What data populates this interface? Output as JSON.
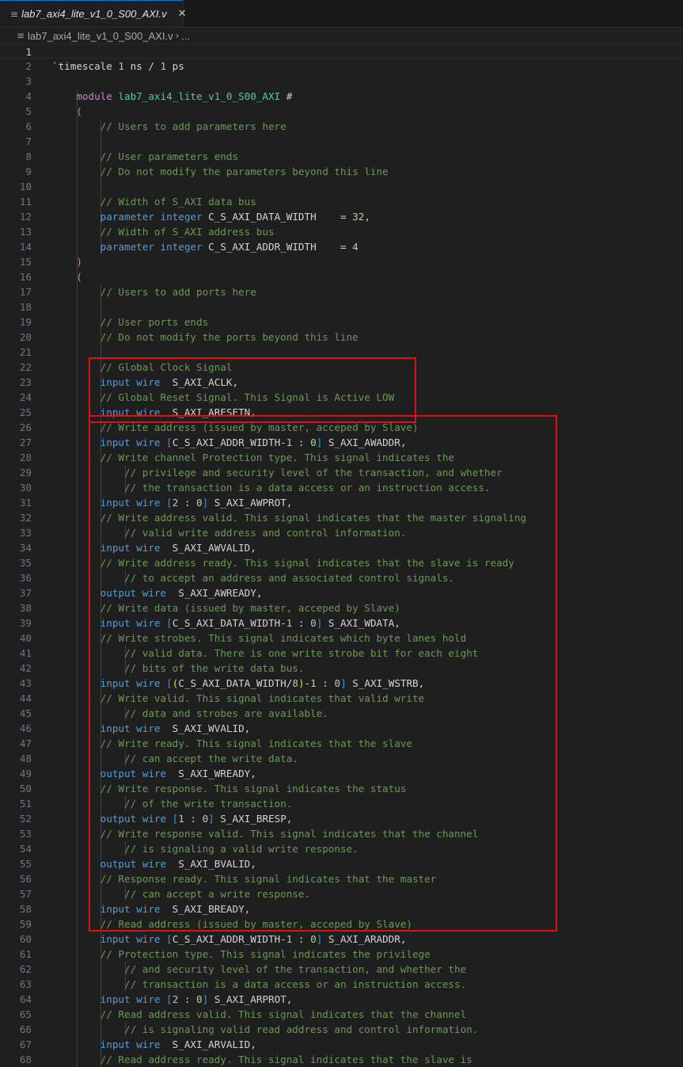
{
  "tab": {
    "title": "lab7_axi4_lite_v1_0_S00_AXI.v",
    "file_icon": "≡",
    "close_icon": "✕"
  },
  "breadcrumb": {
    "file": "lab7_axi4_lite_v1_0_S00_AXI.v",
    "separator": "›",
    "more": "..."
  },
  "highlights": [
    {
      "name": "highlight-global-signals",
      "from_line": 22,
      "to_line": 25
    },
    {
      "name": "highlight-write-channel",
      "from_line": 26,
      "to_line": 59
    }
  ],
  "colors": {
    "keyword": "#569cd6",
    "comment": "#6a9955",
    "number": "#b5cea8",
    "highlight_box": "#e01010",
    "background": "#1f1f1f"
  },
  "lines": [
    {
      "n": "1",
      "t": [],
      "current": true
    },
    {
      "n": "2",
      "t": [
        [
          "`timescale ",
          "df"
        ],
        [
          "1",
          "nm"
        ],
        [
          " ns / ",
          "df"
        ],
        [
          "1",
          "nm"
        ],
        [
          " ps",
          "df"
        ]
      ]
    },
    {
      "n": "3",
      "t": []
    },
    {
      "n": "4",
      "t": [
        [
          "    "
        ],
        [
          "module ",
          "kc"
        ],
        [
          "lab7_axi4_lite_v1_0_S00_AXI",
          "ty"
        ],
        [
          " #",
          "df"
        ]
      ],
      "g": [
        1
      ]
    },
    {
      "n": "5",
      "t": [
        [
          "    "
        ],
        [
          "(",
          "br2"
        ]
      ],
      "g": [
        1
      ]
    },
    {
      "n": "6",
      "t": [
        [
          "        "
        ],
        [
          "// Users to add parameters here",
          "cm"
        ]
      ],
      "g": [
        1,
        2
      ]
    },
    {
      "n": "7",
      "t": [],
      "g": [
        1,
        2
      ]
    },
    {
      "n": "8",
      "t": [
        [
          "        "
        ],
        [
          "// User parameters ends",
          "cm"
        ]
      ],
      "g": [
        1,
        2
      ]
    },
    {
      "n": "9",
      "t": [
        [
          "        "
        ],
        [
          "// Do not modify the parameters beyond this line",
          "cm"
        ]
      ],
      "g": [
        1,
        2
      ]
    },
    {
      "n": "10",
      "t": [],
      "g": [
        1,
        2
      ]
    },
    {
      "n": "11",
      "t": [
        [
          "        "
        ],
        [
          "// Width of S_AXI data bus",
          "cm"
        ]
      ],
      "g": [
        1,
        2
      ]
    },
    {
      "n": "12",
      "t": [
        [
          "        "
        ],
        [
          "parameter ",
          "kw"
        ],
        [
          "integer ",
          "kw"
        ],
        [
          "C_S_AXI_DATA_WIDTH    = ",
          "df"
        ],
        [
          "32",
          "nm"
        ],
        [
          ",",
          "df"
        ]
      ],
      "g": [
        1,
        2
      ]
    },
    {
      "n": "13",
      "t": [
        [
          "        "
        ],
        [
          "// Width of S_AXI address bus",
          "cm"
        ]
      ],
      "g": [
        1,
        2
      ]
    },
    {
      "n": "14",
      "t": [
        [
          "        "
        ],
        [
          "parameter ",
          "kw"
        ],
        [
          "integer ",
          "kw"
        ],
        [
          "C_S_AXI_ADDR_WIDTH    = ",
          "df"
        ],
        [
          "4",
          "nm"
        ]
      ],
      "g": [
        1,
        2
      ]
    },
    {
      "n": "15",
      "t": [
        [
          "    "
        ],
        [
          ")",
          "br2"
        ]
      ],
      "g": [
        1
      ]
    },
    {
      "n": "16",
      "t": [
        [
          "    "
        ],
        [
          "(",
          "br2"
        ]
      ],
      "g": [
        1
      ]
    },
    {
      "n": "17",
      "t": [
        [
          "        "
        ],
        [
          "// Users to add ports here",
          "cm"
        ]
      ],
      "g": [
        1,
        2
      ]
    },
    {
      "n": "18",
      "t": [],
      "g": [
        1,
        2
      ]
    },
    {
      "n": "19",
      "t": [
        [
          "        "
        ],
        [
          "// User ports ends",
          "cm"
        ]
      ],
      "g": [
        1,
        2
      ]
    },
    {
      "n": "20",
      "t": [
        [
          "        "
        ],
        [
          "// Do not modify the ports beyond this line",
          "cm"
        ]
      ],
      "g": [
        1,
        2
      ]
    },
    {
      "n": "21",
      "t": [],
      "g": [
        1,
        2
      ]
    },
    {
      "n": "22",
      "t": [
        [
          "        "
        ],
        [
          "// Global Clock Signal",
          "cm"
        ]
      ],
      "g": [
        1,
        2
      ]
    },
    {
      "n": "23",
      "t": [
        [
          "        "
        ],
        [
          "input ",
          "kw"
        ],
        [
          "wire ",
          "kw"
        ],
        [
          " S_AXI_ACLK,",
          "df"
        ]
      ],
      "g": [
        1,
        2
      ]
    },
    {
      "n": "24",
      "t": [
        [
          "        "
        ],
        [
          "// Global Reset Signal. This Signal is Active LOW",
          "cm"
        ]
      ],
      "g": [
        1,
        2
      ]
    },
    {
      "n": "25",
      "t": [
        [
          "        "
        ],
        [
          "input ",
          "kw"
        ],
        [
          "wire ",
          "kw"
        ],
        [
          " S_AXI_ARESETN,",
          "df"
        ]
      ],
      "g": [
        1,
        2
      ]
    },
    {
      "n": "26",
      "t": [
        [
          "        "
        ],
        [
          "// Write address (issued by master, acceped by Slave)",
          "cm"
        ]
      ],
      "g": [
        1,
        2
      ]
    },
    {
      "n": "27",
      "t": [
        [
          "        "
        ],
        [
          "input ",
          "kw"
        ],
        [
          "wire ",
          "kw"
        ],
        [
          "[",
          "br3"
        ],
        [
          "C_S_AXI_ADDR_WIDTH-",
          "df"
        ],
        [
          "1",
          "nm"
        ],
        [
          " : ",
          "df"
        ],
        [
          "0",
          "nm"
        ],
        [
          "]",
          "br3"
        ],
        [
          " S_AXI_AWADDR,",
          "df"
        ]
      ],
      "g": [
        1,
        2
      ]
    },
    {
      "n": "28",
      "t": [
        [
          "        "
        ],
        [
          "// Write channel Protection type. This signal indicates the",
          "cm"
        ]
      ],
      "g": [
        1,
        2
      ]
    },
    {
      "n": "29",
      "t": [
        [
          "            "
        ],
        [
          "// privilege and security level of the transaction, and whether",
          "cm"
        ]
      ],
      "g": [
        1,
        2,
        3
      ]
    },
    {
      "n": "30",
      "t": [
        [
          "            "
        ],
        [
          "// the transaction is a data access or an instruction access.",
          "cm"
        ]
      ],
      "g": [
        1,
        2,
        3
      ]
    },
    {
      "n": "31",
      "t": [
        [
          "        "
        ],
        [
          "input ",
          "kw"
        ],
        [
          "wire ",
          "kw"
        ],
        [
          "[",
          "br3"
        ],
        [
          "2",
          "nm"
        ],
        [
          " : ",
          "df"
        ],
        [
          "0",
          "nm"
        ],
        [
          "]",
          "br3"
        ],
        [
          " S_AXI_AWPROT,",
          "df"
        ]
      ],
      "g": [
        1,
        2
      ]
    },
    {
      "n": "32",
      "t": [
        [
          "        "
        ],
        [
          "// Write address valid. This signal indicates that the master signaling",
          "cm"
        ]
      ],
      "g": [
        1,
        2
      ]
    },
    {
      "n": "33",
      "t": [
        [
          "            "
        ],
        [
          "// valid write address and control information.",
          "cm"
        ]
      ],
      "g": [
        1,
        2,
        3
      ]
    },
    {
      "n": "34",
      "t": [
        [
          "        "
        ],
        [
          "input ",
          "kw"
        ],
        [
          "wire ",
          "kw"
        ],
        [
          " S_AXI_AWVALID,",
          "df"
        ]
      ],
      "g": [
        1,
        2
      ]
    },
    {
      "n": "35",
      "t": [
        [
          "        "
        ],
        [
          "// Write address ready. This signal indicates that the slave is ready",
          "cm"
        ]
      ],
      "g": [
        1,
        2
      ]
    },
    {
      "n": "36",
      "t": [
        [
          "            "
        ],
        [
          "// to accept an address and associated control signals.",
          "cm"
        ]
      ],
      "g": [
        1,
        2,
        3
      ]
    },
    {
      "n": "37",
      "t": [
        [
          "        "
        ],
        [
          "output ",
          "kw"
        ],
        [
          "wire ",
          "kw"
        ],
        [
          " S_AXI_AWREADY,",
          "df"
        ]
      ],
      "g": [
        1,
        2
      ]
    },
    {
      "n": "38",
      "t": [
        [
          "        "
        ],
        [
          "// Write data (issued by master, acceped by Slave)",
          "cm"
        ]
      ],
      "g": [
        1,
        2
      ]
    },
    {
      "n": "39",
      "t": [
        [
          "        "
        ],
        [
          "input ",
          "kw"
        ],
        [
          "wire ",
          "kw"
        ],
        [
          "[",
          "br3"
        ],
        [
          "C_S_AXI_DATA_WIDTH-",
          "df"
        ],
        [
          "1",
          "nm"
        ],
        [
          " : ",
          "df"
        ],
        [
          "0",
          "nm"
        ],
        [
          "]",
          "br3"
        ],
        [
          " S_AXI_WDATA,",
          "df"
        ]
      ],
      "g": [
        1,
        2
      ]
    },
    {
      "n": "40",
      "t": [
        [
          "        "
        ],
        [
          "// Write strobes. This signal indicates which byte lanes hold",
          "cm"
        ]
      ],
      "g": [
        1,
        2
      ]
    },
    {
      "n": "41",
      "t": [
        [
          "            "
        ],
        [
          "// valid data. There is one write strobe bit for each eight",
          "cm"
        ]
      ],
      "g": [
        1,
        2,
        3
      ]
    },
    {
      "n": "42",
      "t": [
        [
          "            "
        ],
        [
          "// bits of the write data bus.",
          "cm"
        ]
      ],
      "g": [
        1,
        2,
        3
      ]
    },
    {
      "n": "43",
      "t": [
        [
          "        "
        ],
        [
          "input ",
          "kw"
        ],
        [
          "wire ",
          "kw"
        ],
        [
          "[",
          "br3"
        ],
        [
          "(",
          "br1"
        ],
        [
          "C_S_AXI_DATA_WIDTH/",
          "df"
        ],
        [
          "8",
          "nm"
        ],
        [
          ")",
          "br1"
        ],
        [
          "-",
          "df"
        ],
        [
          "1",
          "nm"
        ],
        [
          " : ",
          "df"
        ],
        [
          "0",
          "nm"
        ],
        [
          "]",
          "br3"
        ],
        [
          " S_AXI_WSTRB,",
          "df"
        ]
      ],
      "g": [
        1,
        2
      ]
    },
    {
      "n": "44",
      "t": [
        [
          "        "
        ],
        [
          "// Write valid. This signal indicates that valid write",
          "cm"
        ]
      ],
      "g": [
        1,
        2
      ]
    },
    {
      "n": "45",
      "t": [
        [
          "            "
        ],
        [
          "// data and strobes are available.",
          "cm"
        ]
      ],
      "g": [
        1,
        2,
        3
      ]
    },
    {
      "n": "46",
      "t": [
        [
          "        "
        ],
        [
          "input ",
          "kw"
        ],
        [
          "wire ",
          "kw"
        ],
        [
          " S_AXI_WVALID,",
          "df"
        ]
      ],
      "g": [
        1,
        2
      ]
    },
    {
      "n": "47",
      "t": [
        [
          "        "
        ],
        [
          "// Write ready. This signal indicates that the slave",
          "cm"
        ]
      ],
      "g": [
        1,
        2
      ]
    },
    {
      "n": "48",
      "t": [
        [
          "            "
        ],
        [
          "// can accept the write data.",
          "cm"
        ]
      ],
      "g": [
        1,
        2,
        3
      ]
    },
    {
      "n": "49",
      "t": [
        [
          "        "
        ],
        [
          "output ",
          "kw"
        ],
        [
          "wire ",
          "kw"
        ],
        [
          " S_AXI_WREADY,",
          "df"
        ]
      ],
      "g": [
        1,
        2
      ]
    },
    {
      "n": "50",
      "t": [
        [
          "        "
        ],
        [
          "// Write response. This signal indicates the status",
          "cm"
        ]
      ],
      "g": [
        1,
        2
      ]
    },
    {
      "n": "51",
      "t": [
        [
          "            "
        ],
        [
          "// of the write transaction.",
          "cm"
        ]
      ],
      "g": [
        1,
        2,
        3
      ]
    },
    {
      "n": "52",
      "t": [
        [
          "        "
        ],
        [
          "output ",
          "kw"
        ],
        [
          "wire ",
          "kw"
        ],
        [
          "[",
          "br3"
        ],
        [
          "1",
          "nm"
        ],
        [
          " : ",
          "df"
        ],
        [
          "0",
          "nm"
        ],
        [
          "]",
          "br3"
        ],
        [
          " S_AXI_BRESP,",
          "df"
        ]
      ],
      "g": [
        1,
        2
      ]
    },
    {
      "n": "53",
      "t": [
        [
          "        "
        ],
        [
          "// Write response valid. This signal indicates that the channel",
          "cm"
        ]
      ],
      "g": [
        1,
        2
      ]
    },
    {
      "n": "54",
      "t": [
        [
          "            "
        ],
        [
          "// is signaling a valid write response.",
          "cm"
        ]
      ],
      "g": [
        1,
        2,
        3
      ]
    },
    {
      "n": "55",
      "t": [
        [
          "        "
        ],
        [
          "output ",
          "kw"
        ],
        [
          "wire ",
          "kw"
        ],
        [
          " S_AXI_BVALID,",
          "df"
        ]
      ],
      "g": [
        1,
        2
      ]
    },
    {
      "n": "56",
      "t": [
        [
          "        "
        ],
        [
          "// Response ready. This signal indicates that the master",
          "cm"
        ]
      ],
      "g": [
        1,
        2
      ]
    },
    {
      "n": "57",
      "t": [
        [
          "            "
        ],
        [
          "// can accept a write response.",
          "cm"
        ]
      ],
      "g": [
        1,
        2,
        3
      ]
    },
    {
      "n": "58",
      "t": [
        [
          "        "
        ],
        [
          "input ",
          "kw"
        ],
        [
          "wire ",
          "kw"
        ],
        [
          " S_AXI_BREADY,",
          "df"
        ]
      ],
      "g": [
        1,
        2
      ]
    },
    {
      "n": "59",
      "t": [
        [
          "        "
        ],
        [
          "// Read address (issued by master, acceped by Slave)",
          "cm"
        ]
      ],
      "g": [
        1,
        2
      ]
    },
    {
      "n": "60",
      "t": [
        [
          "        "
        ],
        [
          "input ",
          "kw"
        ],
        [
          "wire ",
          "kw"
        ],
        [
          "[",
          "br3"
        ],
        [
          "C_S_AXI_ADDR_WIDTH-",
          "df"
        ],
        [
          "1",
          "nm"
        ],
        [
          " : ",
          "df"
        ],
        [
          "0",
          "nm"
        ],
        [
          "]",
          "br3"
        ],
        [
          " S_AXI_ARADDR,",
          "df"
        ]
      ],
      "g": [
        1,
        2
      ]
    },
    {
      "n": "61",
      "t": [
        [
          "        "
        ],
        [
          "// Protection type. This signal indicates the privilege",
          "cm"
        ]
      ],
      "g": [
        1,
        2
      ]
    },
    {
      "n": "62",
      "t": [
        [
          "            "
        ],
        [
          "// and security level of the transaction, and whether the",
          "cm"
        ]
      ],
      "g": [
        1,
        2,
        3
      ]
    },
    {
      "n": "63",
      "t": [
        [
          "            "
        ],
        [
          "// transaction is a data access or an instruction access.",
          "cm"
        ]
      ],
      "g": [
        1,
        2,
        3
      ]
    },
    {
      "n": "64",
      "t": [
        [
          "        "
        ],
        [
          "input ",
          "kw"
        ],
        [
          "wire ",
          "kw"
        ],
        [
          "[",
          "br3"
        ],
        [
          "2",
          "nm"
        ],
        [
          " : ",
          "df"
        ],
        [
          "0",
          "nm"
        ],
        [
          "]",
          "br3"
        ],
        [
          " S_AXI_ARPROT,",
          "df"
        ]
      ],
      "g": [
        1,
        2
      ]
    },
    {
      "n": "65",
      "t": [
        [
          "        "
        ],
        [
          "// Read address valid. This signal indicates that the channel",
          "cm"
        ]
      ],
      "g": [
        1,
        2
      ]
    },
    {
      "n": "66",
      "t": [
        [
          "            "
        ],
        [
          "// is signaling valid read address and control information.",
          "cm"
        ]
      ],
      "g": [
        1,
        2,
        3
      ]
    },
    {
      "n": "67",
      "t": [
        [
          "        "
        ],
        [
          "input ",
          "kw"
        ],
        [
          "wire ",
          "kw"
        ],
        [
          " S_AXI_ARVALID,",
          "df"
        ]
      ],
      "g": [
        1,
        2
      ]
    },
    {
      "n": "68",
      "t": [
        [
          "        "
        ],
        [
          "// Read address ready. This signal indicates that the slave is",
          "cm"
        ]
      ],
      "g": [
        1,
        2
      ]
    }
  ]
}
